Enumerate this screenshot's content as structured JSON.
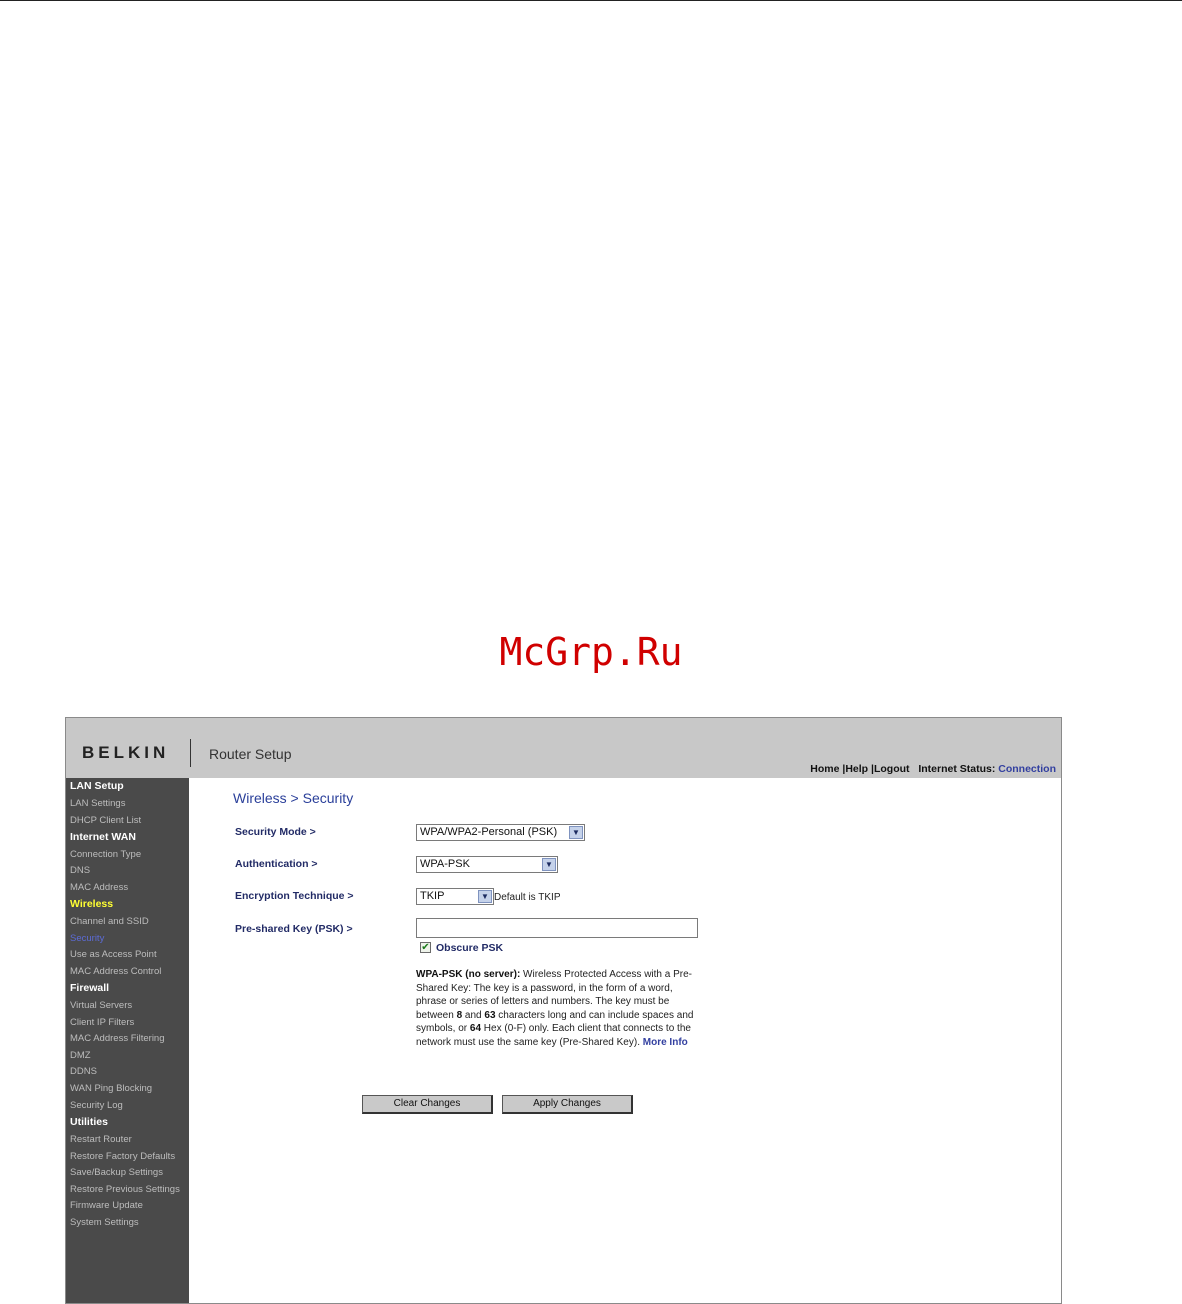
{
  "watermark": "McGrp.Ru",
  "header": {
    "brand": "BELKIN",
    "title": "Router Setup",
    "links": [
      "Home",
      "Help",
      "Logout"
    ],
    "status_label": "Internet Status:",
    "status_value": "Connection"
  },
  "sidebar": {
    "items": [
      {
        "label": "LAN Setup",
        "type": "heading"
      },
      {
        "label": "LAN Settings",
        "type": "link"
      },
      {
        "label": "DHCP Client List",
        "type": "link"
      },
      {
        "label": "Internet WAN",
        "type": "heading"
      },
      {
        "label": "Connection Type",
        "type": "link"
      },
      {
        "label": "DNS",
        "type": "link"
      },
      {
        "label": "MAC Address",
        "type": "link"
      },
      {
        "label": "Wireless",
        "type": "heading-active"
      },
      {
        "label": "Channel and SSID",
        "type": "link"
      },
      {
        "label": "Security",
        "type": "current"
      },
      {
        "label": "Use as Access Point",
        "type": "link"
      },
      {
        "label": "MAC Address Control",
        "type": "link"
      },
      {
        "label": "Firewall",
        "type": "heading"
      },
      {
        "label": "Virtual Servers",
        "type": "link"
      },
      {
        "label": "Client IP Filters",
        "type": "link"
      },
      {
        "label": "MAC Address Filtering",
        "type": "link"
      },
      {
        "label": "DMZ",
        "type": "link"
      },
      {
        "label": "DDNS",
        "type": "link"
      },
      {
        "label": "WAN Ping Blocking",
        "type": "link"
      },
      {
        "label": "Security Log",
        "type": "link"
      },
      {
        "label": "Utilities",
        "type": "heading"
      },
      {
        "label": "Restart Router",
        "type": "link"
      },
      {
        "label": "Restore Factory Defaults",
        "type": "link"
      },
      {
        "label": "Save/Backup Settings",
        "type": "link"
      },
      {
        "label": "Restore Previous Settings",
        "type": "link"
      },
      {
        "label": "Firmware Update",
        "type": "link"
      },
      {
        "label": "System Settings",
        "type": "link"
      }
    ]
  },
  "main": {
    "title": "Wireless > Security",
    "security_mode": {
      "label": "Security Mode >",
      "value": "WPA/WPA2-Personal (PSK)"
    },
    "authentication": {
      "label": "Authentication >",
      "value": "WPA-PSK"
    },
    "encryption": {
      "label": "Encryption Technique >",
      "value": "TKIP",
      "hint": "Default is TKIP"
    },
    "psk": {
      "label": "Pre-shared Key (PSK) >",
      "value": ""
    },
    "obscure": {
      "label": "Obscure PSK",
      "checked": true
    },
    "description": {
      "lead": "WPA-PSK (no server):",
      "text_1": " Wireless Protected Access with a Pre-Shared Key: The key is a password, in the form of a word, phrase or series of letters and numbers. The key must be between ",
      "bold_1": "8",
      "text_2": " and ",
      "bold_2": "63",
      "text_3": " characters long and can include spaces and symbols, or ",
      "bold_3": "64",
      "text_4": " Hex (0-F) only. Each client that connects to the network must use the same key (Pre-Shared Key). ",
      "more": "More Info"
    },
    "buttons": {
      "clear": "Clear Changes",
      "apply": "Apply Changes"
    }
  }
}
